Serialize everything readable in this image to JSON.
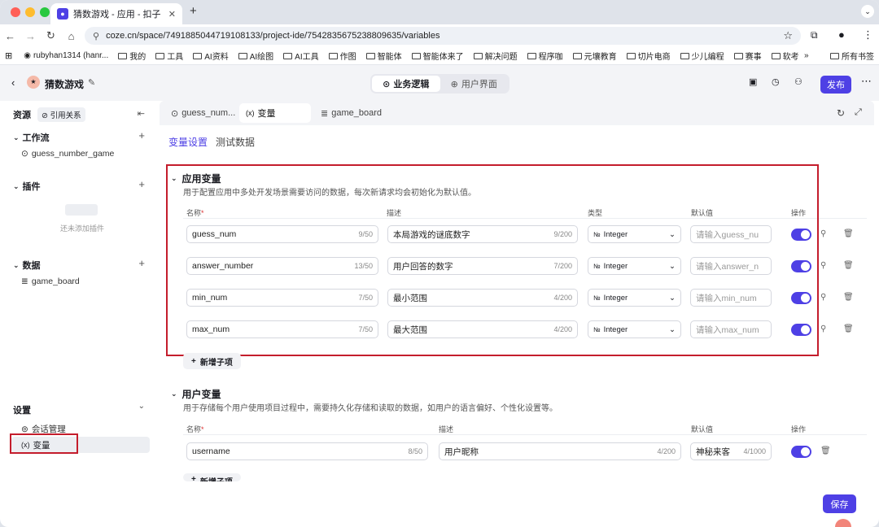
{
  "browser": {
    "tab_title": "猜数游戏 - 应用 - 扣子",
    "url": "coze.cn/space/7491885044719108133/project-ide/7542835675238809635/variables"
  },
  "bookmarks": [
    "rubyhan1314 (hanr...",
    "我的",
    "工具",
    "AI资料",
    "AI绘图",
    "AI工具",
    "作图",
    "智能体",
    "智能体来了",
    "解决问题",
    "程序咖",
    "元壤教育",
    "切片电商",
    "少儿编程",
    "赛事",
    "软考"
  ],
  "bookmarks_more": "»",
  "bookmarks_all": "所有书签",
  "app": {
    "title": "猜数游戏",
    "seg_logic": "业务逻辑",
    "seg_ui": "用户界面",
    "publish": "发布"
  },
  "sidebar": {
    "resources": "资源",
    "ref": "引用关系",
    "workflow": "工作流",
    "workflow_item": "guess_number_game",
    "plugin": "插件",
    "plugin_empty": "还未添加插件",
    "data": "数据",
    "data_item": "game_board",
    "settings": "设置",
    "session": "会话管理",
    "variables": "变量"
  },
  "tabs": {
    "t1": "guess_num...",
    "t2": "变量",
    "t3": "game_board"
  },
  "subtabs": {
    "settings": "变量设置",
    "test": "测试数据"
  },
  "app_vars": {
    "title": "应用变量",
    "desc": "用于配置应用中多处开发场景需要访问的数据，每次新请求均会初始化为默认值。",
    "h_name": "名称",
    "h_desc": "描述",
    "h_type": "类型",
    "h_default": "默认值",
    "h_op": "操作",
    "rows": [
      {
        "name": "guess_num",
        "ncnt": "9/50",
        "desc": "本局游戏的谜底数字",
        "dcnt": "9/200",
        "type": "Integer",
        "ph": "请输入guess_nu"
      },
      {
        "name": "answer_number",
        "ncnt": "13/50",
        "desc": "用户回答的数字",
        "dcnt": "7/200",
        "type": "Integer",
        "ph": "请输入answer_n"
      },
      {
        "name": "min_num",
        "ncnt": "7/50",
        "desc": "最小范围",
        "dcnt": "4/200",
        "type": "Integer",
        "ph": "请输入min_num"
      },
      {
        "name": "max_num",
        "ncnt": "7/50",
        "desc": "最大范围",
        "dcnt": "4/200",
        "type": "Integer",
        "ph": "请输入max_num"
      }
    ],
    "add": "新增子项"
  },
  "user_vars": {
    "title": "用户变量",
    "desc": "用于存储每个用户使用项目过程中，需要持久化存储和读取的数据，如用户的语言偏好、个性化设置等。",
    "h_name": "名称",
    "h_desc": "描述",
    "h_default": "默认值",
    "h_op": "操作",
    "row": {
      "name": "username",
      "ncnt": "8/50",
      "desc": "用户昵称",
      "dcnt": "4/200",
      "def": "神秘来客",
      "defcnt": "4/1000"
    },
    "add": "新增子项"
  },
  "save": "保存",
  "colors": {
    "accent": "#4e40e5",
    "highlight": "#c41d2c"
  }
}
